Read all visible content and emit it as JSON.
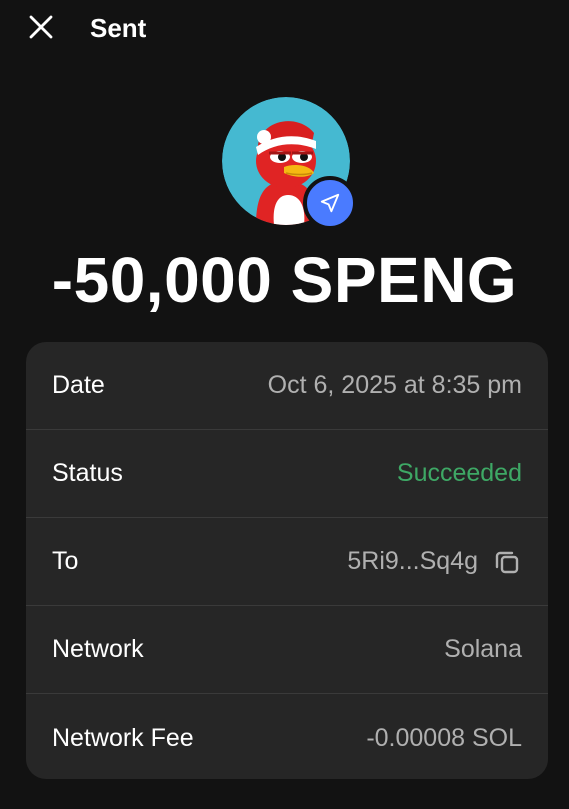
{
  "header": {
    "title": "Sent",
    "close_icon": "close-icon"
  },
  "token": {
    "avatar_icon": "token-avatar",
    "badge_icon": "send-arrow-icon",
    "badge_color": "#4a7bff",
    "amount": "-50,000 SPENG"
  },
  "details": {
    "date": {
      "label": "Date",
      "value": "Oct 6, 2025 at 8:35 pm"
    },
    "status": {
      "label": "Status",
      "value": "Succeeded",
      "color": "#3ea865"
    },
    "to": {
      "label": "To",
      "value": "5Ri9...Sq4g",
      "icon": "copy-icon"
    },
    "network": {
      "label": "Network",
      "value": "Solana"
    },
    "network_fee": {
      "label": "Network Fee",
      "value": "-0.00008 SOL"
    }
  }
}
